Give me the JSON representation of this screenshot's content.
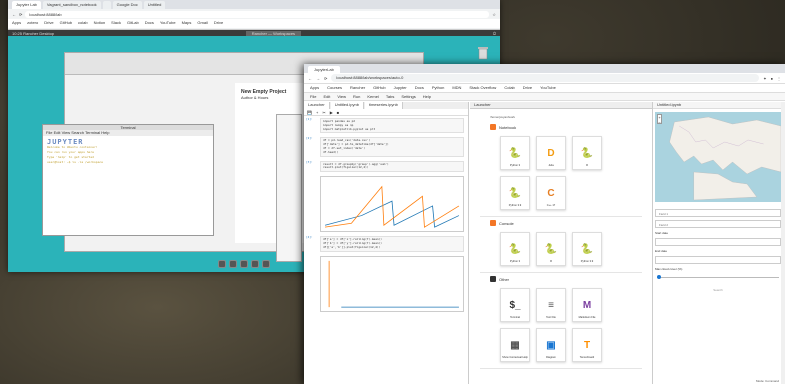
{
  "back": {
    "tabs": [
      "Jupyter Lab",
      "Vagrant_sandbox_notebook",
      "",
      "Google Doc",
      "Untitled"
    ],
    "url": "localhost:8888/lab",
    "bookmarks": [
      "Apps",
      "zotero",
      "Drive",
      "GitHub",
      "colab",
      "Notion",
      "Slack",
      "GitLab",
      "Docs",
      "YouTube",
      "Maps",
      "Gmail",
      "Drive"
    ],
    "vnc_left": "10:25 Rancher Desktop",
    "vnc_mid": "Rancher  —  Workspaces",
    "doc_title": "New Empty Project",
    "doc_line1": "Author & Hours",
    "terminal_title": "Terminal",
    "terminal_menu": [
      "File",
      "Edit",
      "View",
      "Search",
      "Terminal",
      "Help"
    ],
    "terminal_ascii": "JUPYTER",
    "terminal_lines": [
      "Welcome to Ubuntu container!",
      "You can run your apps here",
      "Type 'help' to get started",
      "user@host: ~$ ls -la /workspace"
    ]
  },
  "front": {
    "tabs": [
      "JupyterLab"
    ],
    "url": "localhost:8888/lab/workspaces/auto-0",
    "bookmarks": [
      "Apps",
      "Courses",
      "Rancher",
      "GitHub",
      "Jupyter",
      "Docs",
      "Python",
      "MDN",
      "Stack Overflow",
      "Colab",
      "Drive",
      "YouTube"
    ],
    "menu": [
      "File",
      "Edit",
      "View",
      "Run",
      "Kernel",
      "Tabs",
      "Settings",
      "Help"
    ],
    "notebook": {
      "file_tabs": [
        "Launcher",
        "Untitled.ipynb",
        "timeseries.ipynb"
      ],
      "cells": [
        {
          "prompt": "[1]:",
          "code": "import pandas as pd\nimport numpy as np\nimport matplotlib.pyplot as plt"
        },
        {
          "prompt": "[2]:",
          "code": "df = pd.read_csv('data.csv')\ndf['date'] = pd.to_datetime(df['date'])\ndf = df.set_index('date')\ndf.head()"
        },
        {
          "prompt": "[3]:",
          "code": "result = df.groupby('group').agg('sum')\nresult.plot(figsize=(12,4))"
        },
        {
          "prompt": "[4]:",
          "code": "df['a'] = df['x'].rolling(7).mean()\ndf['b'] = df['y'].rolling(7).mean()\ndf[['a','b']].plot(figsize=(12,4))"
        }
      ]
    },
    "launcher": {
      "path": "/home/jovyan/work",
      "sections": [
        {
          "name": "Notebook",
          "color": "#f37626",
          "cards": [
            {
              "label": "Python 3",
              "icon": "python-icon"
            },
            {
              "label": "Julia",
              "icon": "julia-icon"
            },
            {
              "label": "R",
              "icon": "python-icon"
            },
            {
              "label": "Python 3.9",
              "icon": "python-icon"
            },
            {
              "label": "C++ 17",
              "icon": "cpp-icon"
            }
          ]
        },
        {
          "name": "Console",
          "color": "#f37626",
          "cards": [
            {
              "label": "Python 3",
              "icon": "python-icon"
            },
            {
              "label": "R",
              "icon": "python-icon"
            },
            {
              "label": "Python 3.9",
              "icon": "python-icon"
            }
          ]
        },
        {
          "name": "Other",
          "color": "#333333",
          "cards": [
            {
              "label": "Terminal",
              "icon": "terminal-icon"
            },
            {
              "label": "Text File",
              "icon": "text-file-icon"
            },
            {
              "label": "Markdown File",
              "icon": "markdown-icon"
            },
            {
              "label": "Show Contextual Help",
              "icon": "help-icon"
            },
            {
              "label": "Diagram",
              "icon": "diagram-icon"
            },
            {
              "label": "Tensorboard",
              "icon": "tensorflow-icon"
            }
          ]
        }
      ]
    },
    "map_panel": {
      "tab": "Untitled.ipynb",
      "field1": "Field 1",
      "field2": "Field 2",
      "label1": "Start date",
      "label2": "End date",
      "slider_label": "Max cloud cover (%)",
      "slider_value": 0,
      "button": "Search",
      "status": "Mode: Command"
    }
  }
}
